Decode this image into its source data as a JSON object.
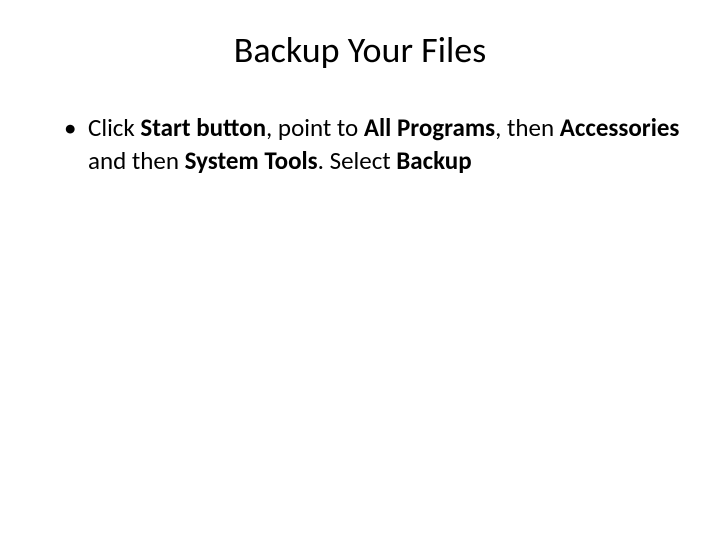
{
  "title": "Backup Your Files",
  "bullet": {
    "seg1": "Click ",
    "bold1": "Start button",
    "seg2": ", point to ",
    "bold2": "All Programs",
    "seg3": ", then ",
    "bold3": "Accessories",
    "seg4": " and then ",
    "bold4": "System Tools",
    "seg5": ". Select ",
    "bold5": "Backup"
  }
}
